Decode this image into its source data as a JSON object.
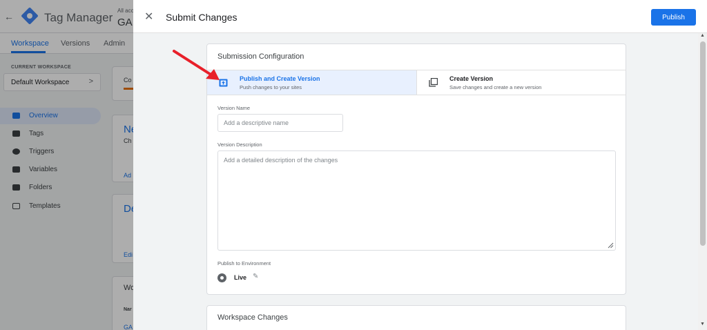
{
  "app": {
    "back_glyph": "←",
    "title": "Tag Manager",
    "account_label": "All acc",
    "account_name": "GA",
    "tabs": [
      {
        "label": "Workspace",
        "active": true
      },
      {
        "label": "Versions",
        "active": false
      },
      {
        "label": "Admin",
        "active": false
      }
    ],
    "current_workspace_label": "CURRENT WORKSPACE",
    "workspace_name": "Default Workspace",
    "workspace_chevron": ">",
    "nav": [
      {
        "label": "Overview",
        "icon": "overview-icon",
        "active": true
      },
      {
        "label": "Tags",
        "icon": "tag-icon",
        "active": false
      },
      {
        "label": "Triggers",
        "icon": "trigger-icon",
        "active": false
      },
      {
        "label": "Variables",
        "icon": "variables-icon",
        "active": false
      },
      {
        "label": "Folders",
        "icon": "folder-icon",
        "active": false
      },
      {
        "label": "Templates",
        "icon": "template-icon",
        "active": false
      }
    ],
    "card_fragments": [
      "Co",
      "Ne",
      "Ch",
      "Ad",
      "De",
      "Edi",
      "Wo",
      "Nar",
      "GA"
    ]
  },
  "dialog": {
    "close_glyph": "✕",
    "title": "Submit Changes",
    "publish_label": "Publish",
    "submission_config_title": "Submission Configuration",
    "options": [
      {
        "title": "Publish and Create Version",
        "subtitle": "Push changes to your sites",
        "icon": "publish-icon",
        "selected": true
      },
      {
        "title": "Create Version",
        "subtitle": "Save changes and create a new version",
        "icon": "copy-version-icon",
        "selected": false
      }
    ],
    "version_name_label": "Version Name",
    "version_name_placeholder": "Add a descriptive name",
    "version_description_label": "Version Description",
    "version_description_placeholder": "Add a detailed description of the changes",
    "publish_env_label": "Publish to Environment",
    "environment_name": "Live",
    "edit_glyph": "✎",
    "workspace_changes_title": "Workspace Changes"
  },
  "colors": {
    "accent": "#1a73e8",
    "selected_bg": "#e8f0fe",
    "annotation_arrow": "#e8202a"
  }
}
